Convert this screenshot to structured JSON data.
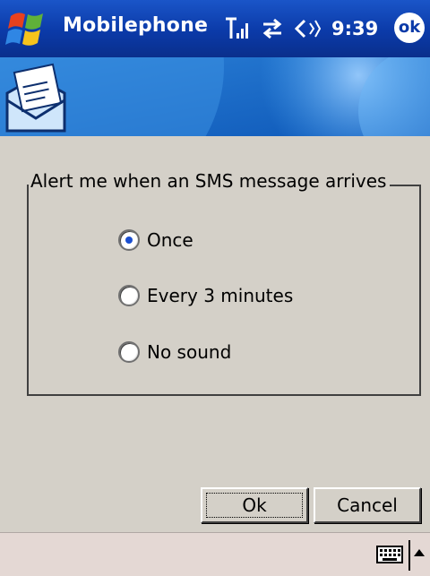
{
  "titlebar": {
    "app_title": "Mobilephone",
    "time": "9:39",
    "ok_label": "ok",
    "icons": [
      "start-flag-icon",
      "signal-strength-icon",
      "connectivity-icon",
      "volume-icon"
    ]
  },
  "banner": {
    "icon": "envelope-icon"
  },
  "alert_group": {
    "legend": "Alert me when an SMS message arrives",
    "options": [
      {
        "label": "Once",
        "selected": true
      },
      {
        "label": "Every 3 minutes",
        "selected": false
      },
      {
        "label": "No sound",
        "selected": false
      }
    ]
  },
  "buttons": {
    "ok": "Ok",
    "cancel": "Cancel"
  },
  "bottombar": {
    "icons": [
      "keyboard-icon",
      "arrow-up-icon"
    ]
  },
  "colors": {
    "titlebar": "#0b3aa8",
    "dialog_bg": "#d4d0c8",
    "bottombar": "#e4d8d4",
    "radio_selected": "#1b4fd0"
  }
}
